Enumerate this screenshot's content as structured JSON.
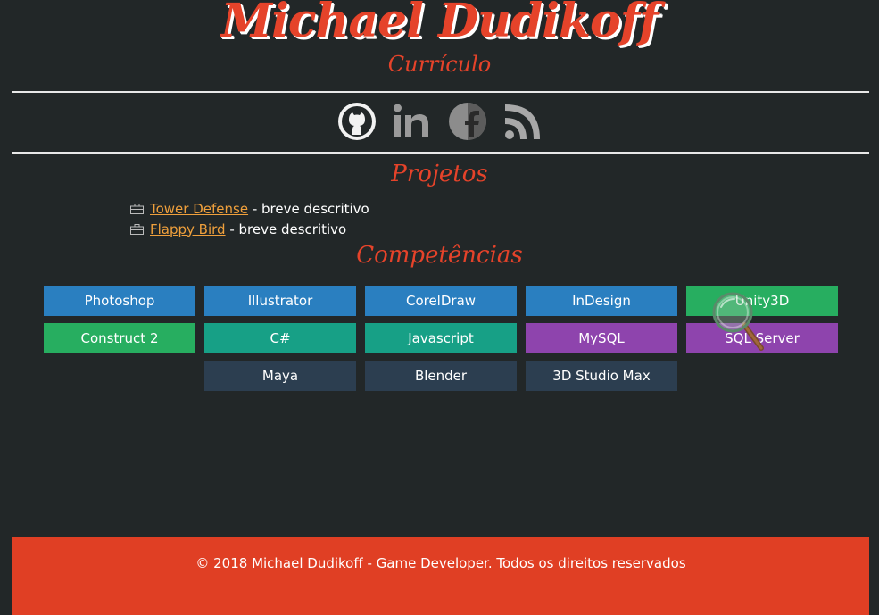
{
  "header": {
    "name": "Michael Dudikoff",
    "subtitle": "Currículo"
  },
  "social": [
    {
      "icon": "github-icon"
    },
    {
      "icon": "linkedin-icon"
    },
    {
      "icon": "facebook-icon"
    },
    {
      "icon": "rss-icon"
    }
  ],
  "projects": {
    "title": "Projetos",
    "items": [
      {
        "link": "Tower Defense",
        "desc": " - breve descritivo"
      },
      {
        "link": "Flappy Bird",
        "desc": " - breve descritivo"
      }
    ]
  },
  "skills": {
    "title": "Competências",
    "items": [
      {
        "label": "Photoshop",
        "color": "#2a7fc0"
      },
      {
        "label": "Illustrator",
        "color": "#2a7fc0"
      },
      {
        "label": "CorelDraw",
        "color": "#2a7fc0"
      },
      {
        "label": "InDesign",
        "color": "#2a7fc0"
      },
      {
        "label": "Unity3D",
        "color": "#27ae60"
      },
      {
        "label": "Construct 2",
        "color": "#27ae60"
      },
      {
        "label": "C#",
        "color": "#17a086"
      },
      {
        "label": "Javascript",
        "color": "#17a086"
      },
      {
        "label": "MySQL",
        "color": "#8e44ad"
      },
      {
        "label": "SQL Server",
        "color": "#8e44ad"
      },
      {
        "label": "Maya",
        "color": "#2c3e50"
      },
      {
        "label": "Blender",
        "color": "#2c3e50"
      },
      {
        "label": "3D Studio Max",
        "color": "#2c3e50"
      }
    ]
  },
  "footer": {
    "text": "© 2018 Michael Dudikoff - Game Developer. Todos os direitos reservados"
  },
  "colors": {
    "background": "#222728",
    "accent": "#e5432a",
    "link": "#f0a03c",
    "footer": "#e03f24"
  }
}
